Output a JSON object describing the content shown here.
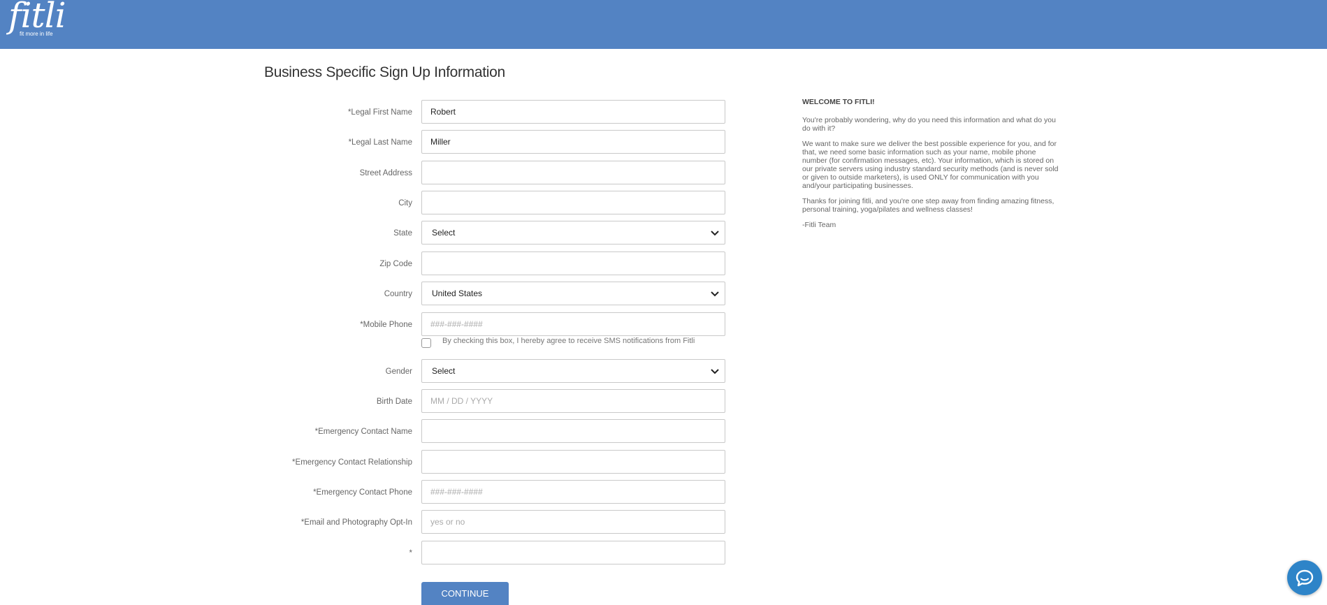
{
  "header": {
    "logo_word": "fitli",
    "logo_tagline": "fit more in life",
    "bg_color": "#5383c3"
  },
  "page_title": "Business Specific Sign Up Information",
  "form": {
    "first_name": {
      "label": "*Legal First Name",
      "value": "Robert"
    },
    "last_name": {
      "label": "*Legal Last Name",
      "value": "Miller"
    },
    "street": {
      "label": "Street Address",
      "value": ""
    },
    "city": {
      "label": "City",
      "value": ""
    },
    "state": {
      "label": "State",
      "value": "Select"
    },
    "zip": {
      "label": "Zip Code",
      "value": ""
    },
    "country": {
      "label": "Country",
      "value": "United States"
    },
    "mobile": {
      "label": "*Mobile Phone",
      "placeholder": "###-###-####"
    },
    "sms_optin": {
      "text": "By checking this box, I hereby agree to receive SMS notifications from Fitli",
      "checked": false
    },
    "gender": {
      "label": "Gender",
      "value": "Select"
    },
    "birth_date": {
      "label": "Birth Date",
      "placeholder": "MM / DD / YYYY"
    },
    "emergency_name": {
      "label": "*Emergency Contact Name",
      "value": ""
    },
    "emergency_relationship": {
      "label": "*Emergency Contact Relationship",
      "value": ""
    },
    "emergency_phone": {
      "label": "*Emergency Contact Phone",
      "placeholder": "###-###-####"
    },
    "email_photo_optin": {
      "label": "*Email and Photography Opt-In",
      "placeholder": "yes or no"
    },
    "unnamed": {
      "label": "*",
      "value": ""
    },
    "continue_label": "CONTINUE"
  },
  "welcome": {
    "title": "WELCOME TO FITLI!",
    "p1": "You're probably wondering, why do you need this information and what do you do with it?",
    "p2": "We want to make sure we deliver the best possible experience for you, and for that, we need some basic information such as your name, mobile phone number (for confirmation messages, etc).  Your information, which is stored on our private servers using industry standard security methods (and is never sold or given to outside marketers), is used ONLY for communication with you and/your participating businesses.",
    "p3": "Thanks for joining fitli, and you're one step away from finding amazing fitness, personal training, yoga/pilates and wellness classes!",
    "signoff": "-Fitli Team"
  },
  "icons": {
    "chevron": "chevron-down-icon",
    "chat": "chat-bubble-icon"
  }
}
